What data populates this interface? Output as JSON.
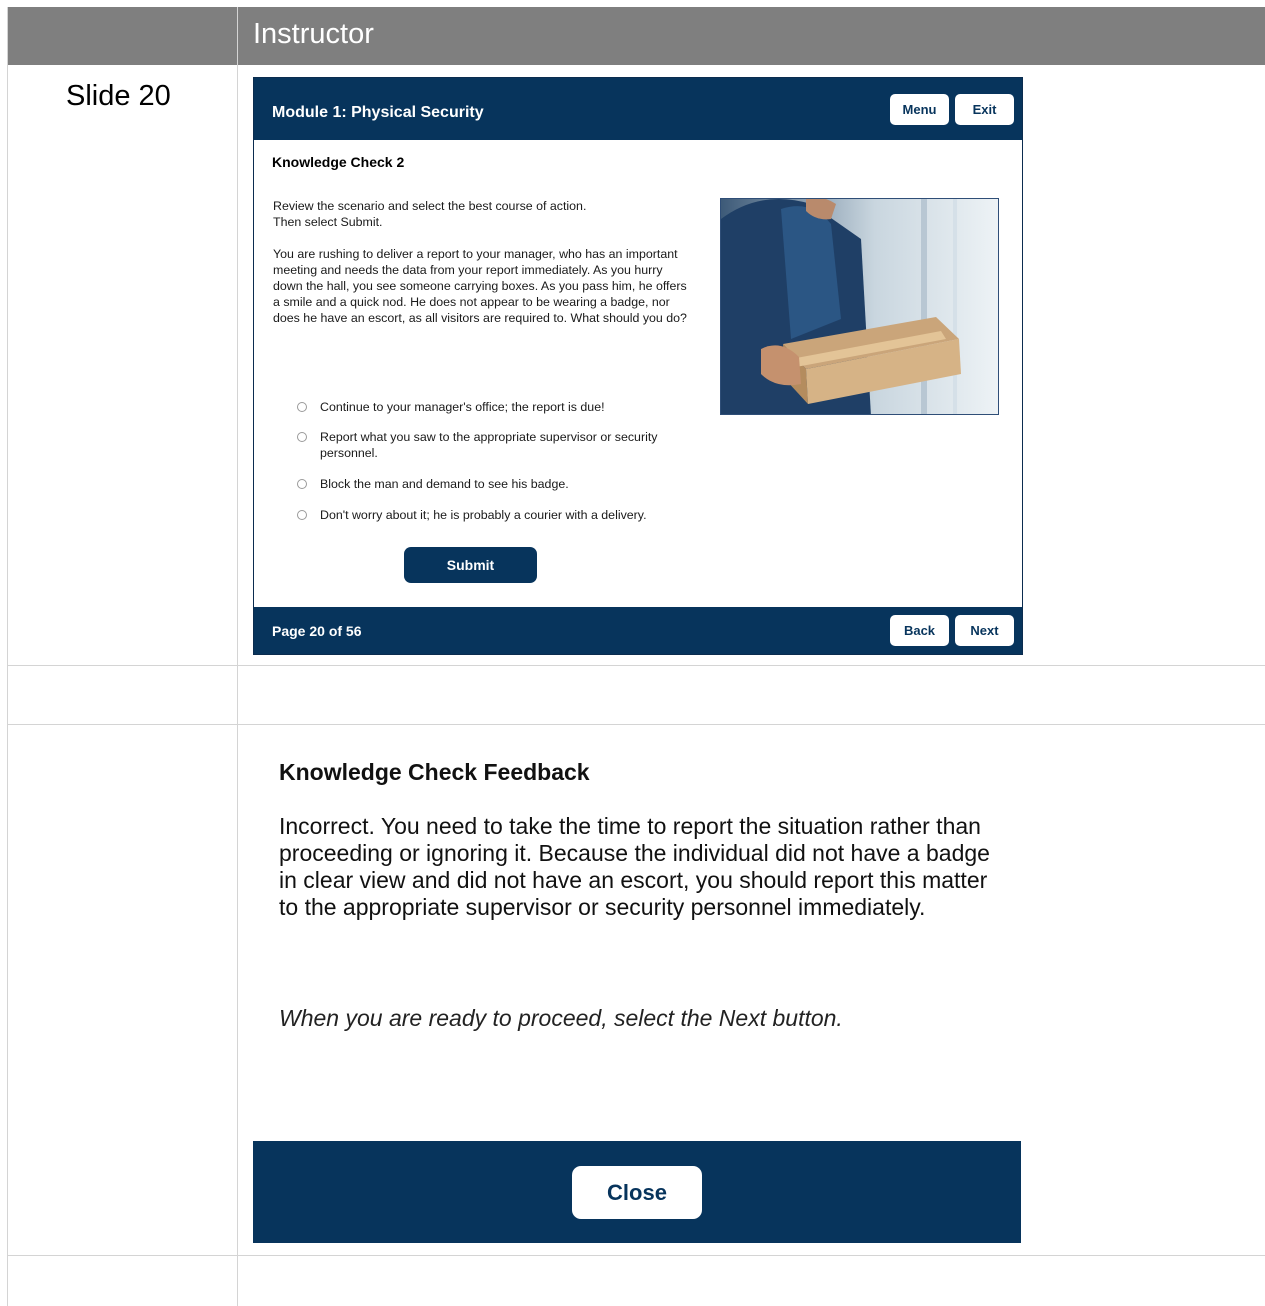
{
  "table": {
    "header": "Instructor",
    "slide_label": "Slide 20"
  },
  "slide": {
    "title": "Module 1: Physical Security",
    "menu_label": "Menu",
    "exit_label": "Exit",
    "heading": "Knowledge Check 2",
    "instructions": [
      "Review the scenario and select the best course of action.",
      "Then select Submit."
    ],
    "scenario": "You are rushing to deliver a report to your manager, who has an important meeting and needs the data from your report immediately. As you hurry down the hall, you see someone carrying boxes. As you pass him, he offers a smile and a quick nod. He does not appear to be wearing a badge, nor does he have an escort, as all visitors are required to. What should you do?",
    "options": [
      "Continue to your manager's office; the report is due!",
      "Report what you saw to the appropriate supervisor or security personnel.",
      "Block the man and demand to see his badge.",
      "Don't worry about it; he is probably a courier with a delivery."
    ],
    "submit_label": "Submit",
    "page_counter": "Page 20 of 56",
    "back_label": "Back",
    "next_label": "Next"
  },
  "feedback": {
    "title": "Knowledge Check Feedback",
    "body": "Incorrect. You need to take the time to report the situation rather than proceeding or ignoring it. Because the individual did not have a badge in clear view and did not have an escort, you should report this matter to the appropriate supervisor or security personnel immediately.",
    "hint": "When you are ready to proceed, select the Next button.",
    "close_label": "Close"
  },
  "colors": {
    "navy": "#07345c",
    "header_gray": "#7f7f7f"
  }
}
